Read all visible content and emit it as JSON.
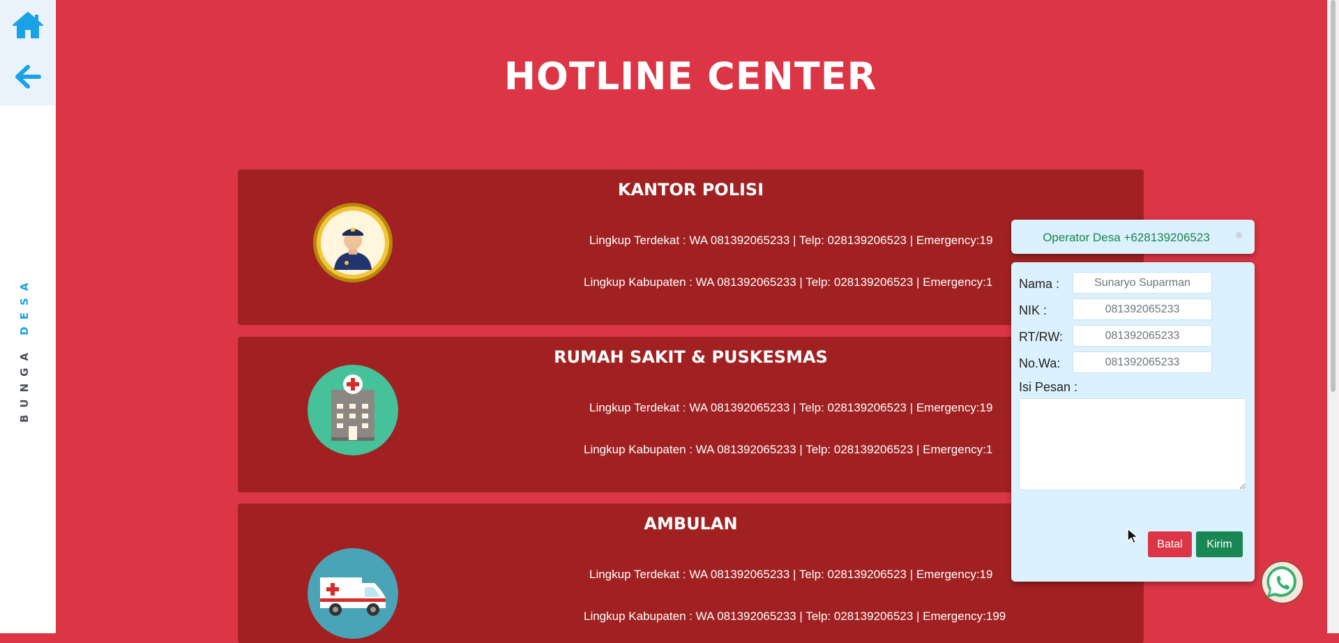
{
  "sidebar": {
    "home_icon": "home-icon",
    "back_icon": "arrow-left-icon",
    "brand_first": "BUNGA ",
    "brand_second": "DESA"
  },
  "page": {
    "title": "HOTLINE CENTER"
  },
  "cards": [
    {
      "title": "KANTOR POLISI",
      "icon": "police-officer-icon",
      "line1": "Lingkup Terdekat : WA 081392065233 | Telp: 028139206523 | Emergency:19",
      "line2": "Lingkup Kabupaten : WA 081392065233 | Telp: 028139206523 | Emergency:1"
    },
    {
      "title": "RUMAH SAKIT & PUSKESMAS",
      "icon": "hospital-icon",
      "line1": "Lingkup Terdekat : WA 081392065233 | Telp: 028139206523 | Emergency:19",
      "line2": "Lingkup Kabupaten : WA 081392065233 | Telp: 028139206523 | Emergency:1"
    },
    {
      "title": "AMBULAN",
      "icon": "ambulance-icon",
      "line1": "Lingkup Terdekat : WA 081392065233 | Telp: 028139206523 | Emergency:19",
      "line2": "Lingkup Kabupaten : WA 081392065233 | Telp: 028139206523 | Emergency:199"
    }
  ],
  "operator": {
    "label": "Operator Desa +628139206523"
  },
  "form": {
    "nama_label": "Nama :",
    "nama_placeholder": "Sunaryo Suparman",
    "nik_label": "NIK :",
    "nik_placeholder": "081392065233",
    "rtrw_label": "RT/RW:",
    "rtrw_placeholder": "081392065233",
    "nowa_label": "No.Wa:",
    "nowa_placeholder": "081392065233",
    "pesan_label": "Isi Pesan :",
    "batal_label": "Batal",
    "kirim_label": "Kirim"
  },
  "colors": {
    "background": "#dc3545",
    "card": "#a12122",
    "accent_blue": "#19a2e6",
    "operator_text": "#1b8449",
    "kirim": "#198754",
    "batal": "#dc3545"
  }
}
